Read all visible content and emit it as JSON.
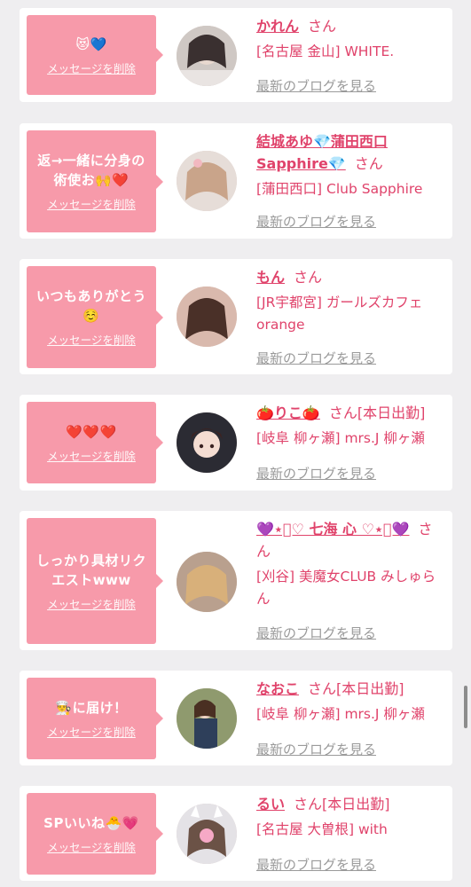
{
  "delete_label": "メッセージを削除",
  "blog_label": "最新のブログを見る",
  "honorific": "さん",
  "colors": {
    "accent": "#e0436b",
    "bubble": "#f79aaa",
    "link_gray": "#9a9a9a",
    "background": "#efeef0"
  },
  "cards": [
    {
      "message": "😻💙",
      "name": "かれん",
      "suffix": "さん",
      "shop": "[名古屋 金山] WHITE.",
      "avatar_icon": "avatar-photo-icon"
    },
    {
      "message": "返→一緒に分身の術使お🙌❤️",
      "name": "結城あゆ💎蒲田西口Sapphire💎",
      "suffix": "さん",
      "shop": "[蒲田西口] Club Sapphire",
      "avatar_icon": "avatar-photo-icon"
    },
    {
      "message": "いつもありがとう☺️",
      "name": "もん",
      "suffix": "さん",
      "shop": "[JR宇都宮] ガールズカフェ orange",
      "avatar_icon": "avatar-photo-icon"
    },
    {
      "message": "❤️❤️❤️",
      "name": "🍅りこ🍅",
      "suffix": "さん[本日出勤]",
      "shop": "[岐阜 柳ヶ瀬] mrs.J 柳ヶ瀬",
      "avatar_icon": "avatar-illustration-icon"
    },
    {
      "message": "しっかり具材リクエストwww",
      "name": "💜⋆͛♡ 七海 心 ♡⋆͛💜",
      "suffix": "さん",
      "shop": "[刈谷] 美魔女CLUB みしゅらん",
      "avatar_icon": "avatar-photo-icon"
    },
    {
      "message": "👨‍🍳に届け！",
      "name": "なおこ",
      "suffix": "さん[本日出勤]",
      "shop": "[岐阜 柳ヶ瀬] mrs.J 柳ヶ瀬",
      "avatar_icon": "avatar-photo-icon"
    },
    {
      "message": "SPいいね🐣💗",
      "name": "るい",
      "suffix": "さん[本日出勤]",
      "shop": "[名古屋 大曽根] with",
      "avatar_icon": "avatar-photo-icon"
    }
  ]
}
